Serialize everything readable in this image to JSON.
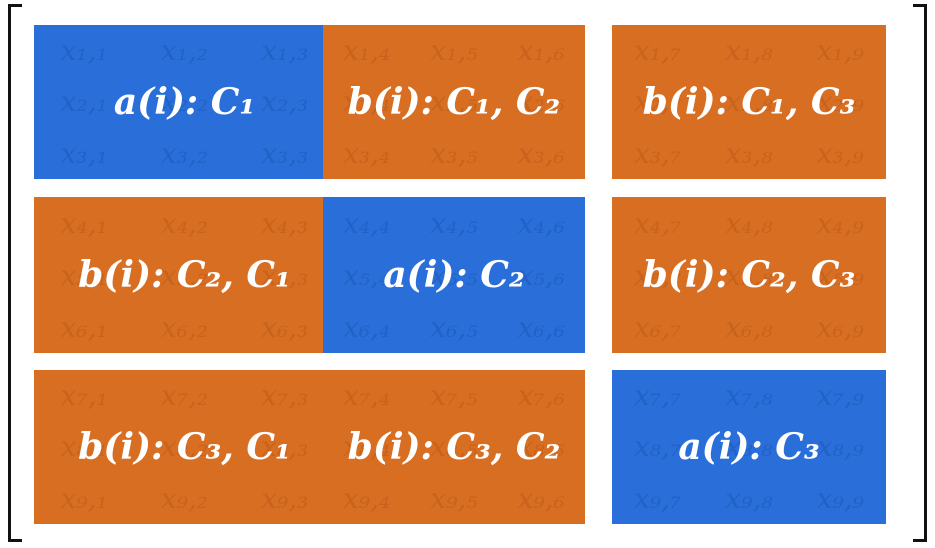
{
  "colors": {
    "type_a": "#2a6fd9",
    "type_b": "#d86e22",
    "bracket": "#111111"
  },
  "blocks": [
    {
      "label": "a(i): C₁",
      "type": "a",
      "cells": [
        "x₁,₁",
        "x₁,₂",
        "x₁,₃",
        "x₂,₁",
        "x₂,₂",
        "x₂,₃",
        "x₃,₁",
        "x₃,₂",
        "x₃,₃"
      ]
    },
    {
      "label": "b(i): C₁, C₂",
      "type": "b",
      "cells": [
        "x₁,₄",
        "x₁,₅",
        "x₁,₆",
        "x₂,₄",
        "x₂,₅",
        "x₂,₆",
        "x₃,₄",
        "x₃,₅",
        "x₃,₆"
      ]
    },
    {
      "label": "b(i): C₁, C₃",
      "type": "b",
      "cells": [
        "x₁,₇",
        "x₁,₈",
        "x₁,₉",
        "x₂,₇",
        "x₂,₈",
        "x₂,₉",
        "x₃,₇",
        "x₃,₈",
        "x₃,₉"
      ]
    },
    {
      "label": "b(i): C₂, C₁",
      "type": "b",
      "cells": [
        "x₄,₁",
        "x₄,₂",
        "x₄,₃",
        "x₅,₁",
        "x₅,₂",
        "x₅,₃",
        "x₆,₁",
        "x₆,₂",
        "x₆,₃"
      ]
    },
    {
      "label": "a(i): C₂",
      "type": "a",
      "cells": [
        "x₄,₄",
        "x₄,₅",
        "x₄,₆",
        "x₅,₄",
        "x₅,₅",
        "x₅,₆",
        "x₆,₄",
        "x₆,₅",
        "x₆,₆"
      ]
    },
    {
      "label": "b(i): C₂, C₃",
      "type": "b",
      "cells": [
        "x₄,₇",
        "x₄,₈",
        "x₄,₉",
        "x₅,₇",
        "x₅,₈",
        "x₅,₉",
        "x₆,₇",
        "x₆,₈",
        "x₆,₉"
      ]
    },
    {
      "label": "b(i): C₃, C₁",
      "type": "b",
      "cells": [
        "x₇,₁",
        "x₇,₂",
        "x₇,₃",
        "x₈,₁",
        "x₈,₂",
        "x₈,₃",
        "x₉,₁",
        "x₉,₂",
        "x₉,₃"
      ]
    },
    {
      "label": "b(i): C₃, C₂",
      "type": "b",
      "cells": [
        "x₇,₄",
        "x₇,₅",
        "x₇,₆",
        "x₈,₄",
        "x₈,₅",
        "x₈,₆",
        "x₉,₄",
        "x₉,₅",
        "x₉,₆"
      ]
    },
    {
      "label": "a(i): C₃",
      "type": "a",
      "cells": [
        "x₇,₇",
        "x₇,₈",
        "x₇,₉",
        "x₈,₇",
        "x₈,₈",
        "x₈,₉",
        "x₉,₇",
        "x₉,₈",
        "x₉,₉"
      ]
    }
  ]
}
